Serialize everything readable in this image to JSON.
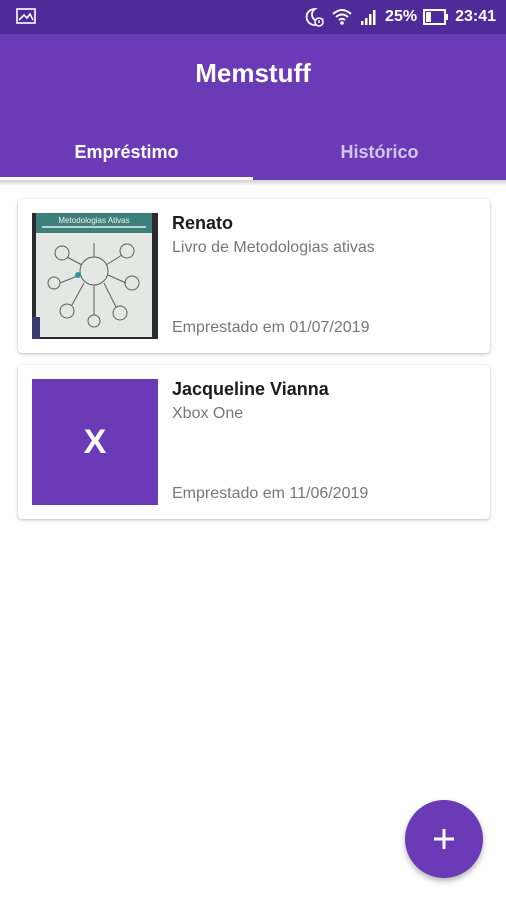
{
  "status_bar": {
    "battery": "25%",
    "time": "23:41",
    "icons": [
      "image-icon",
      "dnd-moon-icon",
      "wifi-icon",
      "signal-icon",
      "battery-icon"
    ]
  },
  "app": {
    "title": "Memstuff",
    "accent_color": "#6b3ab7",
    "status_color": "#4f2a99"
  },
  "tabs": [
    {
      "label": "Empréstimo",
      "active": true
    },
    {
      "label": "Histórico",
      "active": false
    }
  ],
  "loans": [
    {
      "name": "Renato",
      "item": "Livro de Metodologias ativas",
      "date": "Emprestado em 01/07/2019",
      "thumbnail": "book-photo",
      "photo_caption": "Metodologias Ativas"
    },
    {
      "name": "Jacqueline Vianna",
      "item": "Xbox One",
      "date": "Emprestado em 11/06/2019",
      "thumbnail_letter": "X"
    }
  ],
  "fab": {
    "icon": "plus-icon"
  }
}
